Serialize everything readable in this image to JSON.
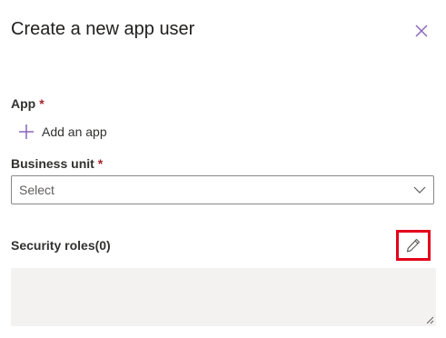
{
  "panel": {
    "title": "Create a new app user",
    "close_icon": "close-icon"
  },
  "app_field": {
    "label": "App",
    "required_marker": "*",
    "add_label": "Add an app",
    "add_icon": "plus-icon"
  },
  "business_unit_field": {
    "label": "Business unit",
    "required_marker": "*",
    "selected_value": "Select",
    "dropdown_icon": "chevron-down-icon"
  },
  "security_roles": {
    "label": "Security roles(0)",
    "edit_icon": "pencil-icon"
  },
  "colors": {
    "accent": "#8764b8",
    "required": "#a4262c",
    "highlight_box": "#e3001b",
    "roles_area_bg": "#f3f2f1"
  }
}
